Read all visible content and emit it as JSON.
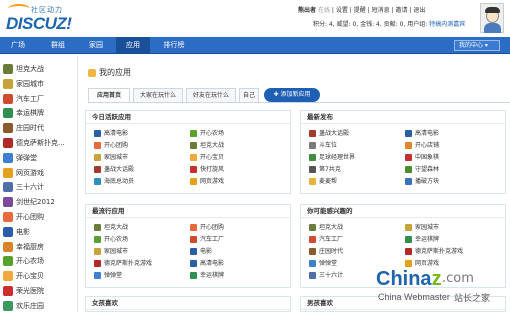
{
  "header": {
    "logo_sub": "社区动力",
    "logo_main": "DISCUZ!",
    "user_line": {
      "username": "熊出者",
      "status": "在线",
      "links": [
        "设置",
        "提醒",
        "短消息",
        "邀请",
        "退出"
      ]
    },
    "credits_line": "积分: 4, 威望: 0, 金钱: 4, 贡献: 0, 用户组:",
    "usergroup": "特搞内测嘉宾"
  },
  "nav": {
    "items": [
      "广场",
      "群组",
      "家园",
      "应用",
      "排行榜"
    ],
    "active_index": 3,
    "my_center": "我的中心 ▾"
  },
  "sidebar": {
    "items": [
      {
        "label": "坦克大战",
        "color": "#6a7d3a"
      },
      {
        "label": "家园城市",
        "color": "#c8a23b"
      },
      {
        "label": "汽车工厂",
        "color": "#d04a2f"
      },
      {
        "label": "幸运棋牌",
        "color": "#2f8f4e"
      },
      {
        "label": "庄园时代",
        "color": "#8b5a2b"
      },
      {
        "label": "德克萨斯扑克...",
        "color": "#b02a2a"
      },
      {
        "label": "弹弹堂",
        "color": "#3f7fcf"
      },
      {
        "label": "网页游戏",
        "color": "#e4a11b"
      },
      {
        "label": "三十六计",
        "color": "#4f6fa8"
      },
      {
        "label": "剑世纪2012",
        "color": "#7b4b9e"
      },
      {
        "label": "开心团购",
        "color": "#e86a3c"
      },
      {
        "label": "电影",
        "color": "#2a5fa8"
      },
      {
        "label": "幸福厨房",
        "color": "#d9832b"
      },
      {
        "label": "开心农场",
        "color": "#5aa02c"
      },
      {
        "label": "开心宝贝",
        "color": "#f0a83a"
      },
      {
        "label": "荣光医院",
        "color": "#cc2e2e"
      },
      {
        "label": "欢乐庄园",
        "color": "#3a9a5b"
      }
    ]
  },
  "main": {
    "title": "我的应用",
    "tabs": [
      "应用首页",
      "大家在玩什么",
      "好友在玩什么",
      "自己"
    ],
    "add_button": "✚ 添加新应用",
    "panels": {
      "today": {
        "title": "今日活跃应用",
        "apps": [
          {
            "label": "高清电影",
            "color": "#2a5fa8"
          },
          {
            "label": "开心农场",
            "color": "#5aa02c"
          },
          {
            "label": "开心团购",
            "color": "#e86a3c"
          },
          {
            "label": "坦克大战",
            "color": "#6a7d3a"
          },
          {
            "label": "家园城市",
            "color": "#c8a23b"
          },
          {
            "label": "开心宝贝",
            "color": "#f0a83a"
          },
          {
            "label": "蛊战大话殿",
            "color": "#a33b2a"
          },
          {
            "label": "快打旋风",
            "color": "#c42f2f"
          },
          {
            "label": "海底总动员",
            "color": "#2f8fbf"
          },
          {
            "label": "网页游戏",
            "color": "#e4a11b"
          }
        ]
      },
      "latest": {
        "title": "最新发布",
        "apps": [
          {
            "label": "蛊战大话殿",
            "color": "#a33b2a"
          },
          {
            "label": "高清电影",
            "color": "#2a5fa8"
          },
          {
            "label": "斗车位",
            "color": "#7a7a7a"
          },
          {
            "label": "开心店铺",
            "color": "#e0862c"
          },
          {
            "label": "足球经理世界",
            "color": "#3f8f3f"
          },
          {
            "label": "中国象棋",
            "color": "#c22f2f"
          },
          {
            "label": "第7共克",
            "color": "#555"
          },
          {
            "label": "守望森林",
            "color": "#4e8a2e"
          },
          {
            "label": "麦麦帮",
            "color": "#e9b23a"
          },
          {
            "label": "播破方块",
            "color": "#3d6fbf"
          }
        ]
      },
      "popular": {
        "title": "最流行应用",
        "apps": [
          {
            "label": "坦克大战",
            "color": "#6a7d3a"
          },
          {
            "label": "开心团购",
            "color": "#e86a3c"
          },
          {
            "label": "开心农场",
            "color": "#5aa02c"
          },
          {
            "label": "汽车工厂",
            "color": "#d04a2f"
          },
          {
            "label": "家园城市",
            "color": "#c8a23b"
          },
          {
            "label": "电影",
            "color": "#2a5fa8"
          },
          {
            "label": "德克萨斯扑克游戏",
            "color": "#b02a2a"
          },
          {
            "label": "高清电影",
            "color": "#2a5fa8"
          },
          {
            "label": "弹弹堂",
            "color": "#3f7fcf"
          },
          {
            "label": "幸运棋牌",
            "color": "#2f8f4e"
          }
        ]
      },
      "maybe": {
        "title": "你可能感兴趣的",
        "apps": [
          {
            "label": "坦克大战",
            "color": "#6a7d3a"
          },
          {
            "label": "家园城市",
            "color": "#c8a23b"
          },
          {
            "label": "汽车工厂",
            "color": "#d04a2f"
          },
          {
            "label": "幸运棋牌",
            "color": "#2f8f4e"
          },
          {
            "label": "庄园时代",
            "color": "#8b5a2b"
          },
          {
            "label": "德克萨斯扑克游戏",
            "color": "#b02a2a"
          },
          {
            "label": "弹弹堂",
            "color": "#3f7fcf"
          },
          {
            "label": "网页游戏",
            "color": "#e4a11b"
          },
          {
            "label": "三十六计",
            "color": "#4f6fa8"
          }
        ]
      },
      "female": {
        "title": "女孩喜欢"
      },
      "male": {
        "title": "男孩喜欢"
      }
    }
  },
  "watermark": {
    "china": "China",
    "z": "z",
    "com": ".com",
    "webmaster": "China Webmaster",
    "cn": "站长之家"
  }
}
